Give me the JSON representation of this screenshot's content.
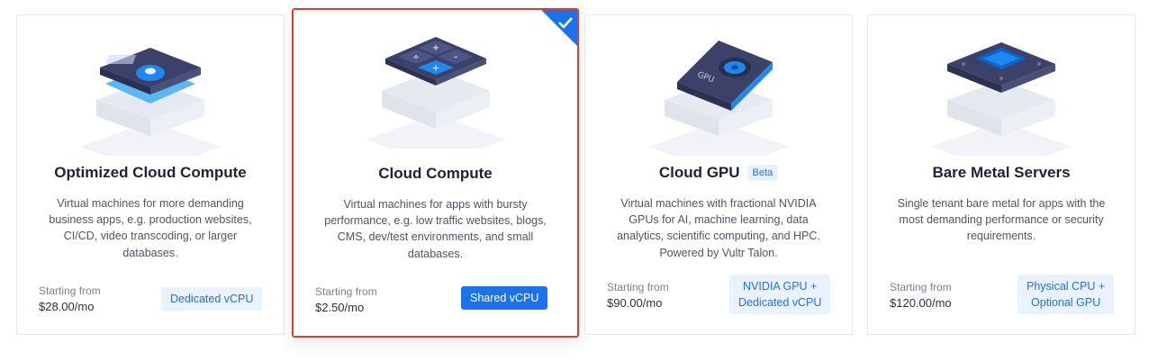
{
  "cards": [
    {
      "title": "Optimized Cloud Compute",
      "description": "Virtual machines for more demanding business apps, e.g. production websites, CI/CD, video transcoding, or larger databases.",
      "starting_label": "Starting from",
      "price": "$28.00/mo",
      "tag": "Dedicated vCPU",
      "selected": false
    },
    {
      "title": "Cloud Compute",
      "description": "Virtual machines for apps with bursty performance, e.g. low traffic websites, blogs, CMS, dev/test environments, and small databases.",
      "starting_label": "Starting from",
      "price": "$2.50/mo",
      "tag": "Shared vCPU",
      "selected": true
    },
    {
      "title": "Cloud GPU",
      "badge": "Beta",
      "description": "Virtual machines with fractional NVIDIA GPUs for AI, machine learning, data analytics, scientific computing, and HPC. Powered by Vultr Talon.",
      "starting_label": "Starting from",
      "price": "$90.00/mo",
      "tag_line1": "NVIDIA GPU +",
      "tag_line2": "Dedicated vCPU",
      "selected": false
    },
    {
      "title": "Bare Metal Servers",
      "description": "Single tenant bare metal for apps with the most demanding performance or security requirements.",
      "starting_label": "Starting from",
      "price": "$120.00/mo",
      "tag_line1": "Physical CPU +",
      "tag_line2": "Optional GPU",
      "selected": false
    }
  ],
  "gpu_label": "GPU",
  "colors": {
    "accent": "#1a73e8",
    "selected_border": "#e53b2c",
    "server_dark": "#3a4064",
    "server_light": "#eef0f5"
  },
  "icons": [
    "optimized-server-illustration",
    "cloud-compute-illustration",
    "gpu-server-illustration",
    "bare-metal-illustration",
    "checkmark-icon"
  ]
}
